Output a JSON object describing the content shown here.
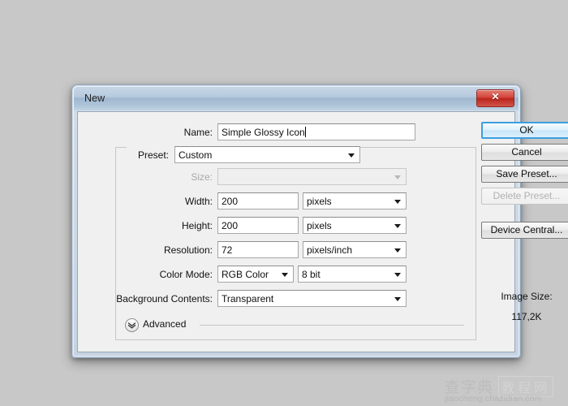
{
  "window": {
    "title": "New",
    "close_icon": "close-icon",
    "close_glyph": "✕"
  },
  "form": {
    "name": {
      "label": "Name:",
      "value": "Simple Glossy Icon",
      "has_caret": true
    },
    "preset": {
      "label": "Preset:",
      "value": "Custom",
      "enabled": true
    },
    "size": {
      "label": "Size:",
      "value": "",
      "enabled": false
    },
    "width": {
      "label": "Width:",
      "value": "200",
      "unit": "pixels"
    },
    "height": {
      "label": "Height:",
      "value": "200",
      "unit": "pixels"
    },
    "resolution": {
      "label": "Resolution:",
      "value": "72",
      "unit": "pixels/inch"
    },
    "color_mode": {
      "label": "Color Mode:",
      "value": "RGB Color",
      "depth": "8 bit"
    },
    "background_contents": {
      "label": "Background Contents:",
      "value": "Transparent"
    },
    "advanced": {
      "label": "Advanced",
      "icon": "chevron-down-circle-icon",
      "expanded": false
    }
  },
  "buttons": {
    "ok": {
      "label": "OK",
      "is_default": true,
      "enabled": true
    },
    "cancel": {
      "label": "Cancel",
      "enabled": true
    },
    "save_preset": {
      "label": "Save Preset...",
      "enabled": true
    },
    "delete_preset": {
      "label": "Delete Preset...",
      "enabled": false
    },
    "device_central": {
      "label": "Device Central...",
      "enabled": true
    }
  },
  "image_size": {
    "title": "Image Size:",
    "value": "117,2K"
  },
  "watermark": {
    "cn_text": "查字典",
    "cn_boxed": "教程网",
    "url": "jiaocheng.chazidian.com"
  },
  "colors": {
    "desktop_background": "#c8c8c8",
    "dialog_face": "#f0f0f0",
    "title_bar_accent": "#aec4d9",
    "close_button_red": "#d3453b",
    "default_button_border": "#3c9ee0",
    "disabled_text": "#a8a8a8"
  }
}
